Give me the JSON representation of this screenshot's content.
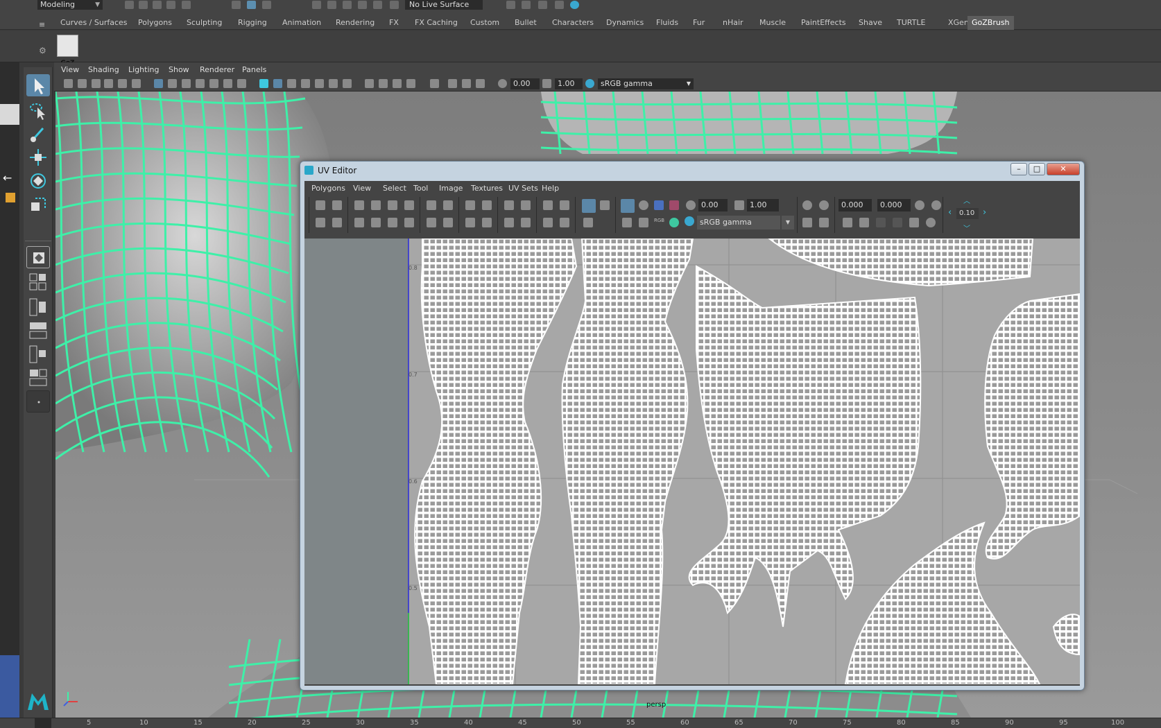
{
  "top_bar": {
    "mode_menu": "Modeling",
    "live_surface": "No Live Surface"
  },
  "shelf": {
    "tabs": [
      "Curves / Surfaces",
      "Polygons",
      "Sculpting",
      "Rigging",
      "Animation",
      "Rendering",
      "FX",
      "FX Caching",
      "Custom",
      "Bullet",
      "Characters",
      "Dynamics",
      "Fluids",
      "Fur",
      "nHair",
      "Muscle",
      "PaintEffects",
      "Shave",
      "TURTLE",
      "XGen",
      "GoZBrush"
    ],
    "active_tab": "GoZBrush",
    "goz_label": "GoZ"
  },
  "panel_menu": [
    "View",
    "Shading",
    "Lighting",
    "Show",
    "Renderer",
    "Panels"
  ],
  "panel_toolbar": {
    "exposure": "0.00",
    "gamma": "1.00",
    "color_space": "sRGB gamma"
  },
  "viewport": {
    "camera_label": "persp"
  },
  "uv_editor": {
    "title": "UV Editor",
    "menu": [
      "Polygons",
      "View",
      "Select",
      "Tool",
      "Image",
      "Textures",
      "UV Sets",
      "Help"
    ],
    "exposure": "0.00",
    "gamma": "1.00",
    "color_space": "sRGB gamma",
    "u_value": "0.000",
    "v_value": "0.000",
    "step": "0.10",
    "grid_labels": [
      "0.8",
      "0.7",
      "0.6",
      "0.5"
    ],
    "wire_color": "#ffffff",
    "bg_color": "#a7a7a7"
  },
  "timeline": {
    "ticks": [
      "5",
      "10",
      "15",
      "20",
      "25",
      "30",
      "35",
      "40",
      "45",
      "50",
      "55",
      "60",
      "65",
      "70",
      "75",
      "80",
      "85",
      "90",
      "95",
      "100"
    ]
  },
  "colors": {
    "wireframe": "#3ef0a8",
    "ui_bg": "#444444"
  }
}
